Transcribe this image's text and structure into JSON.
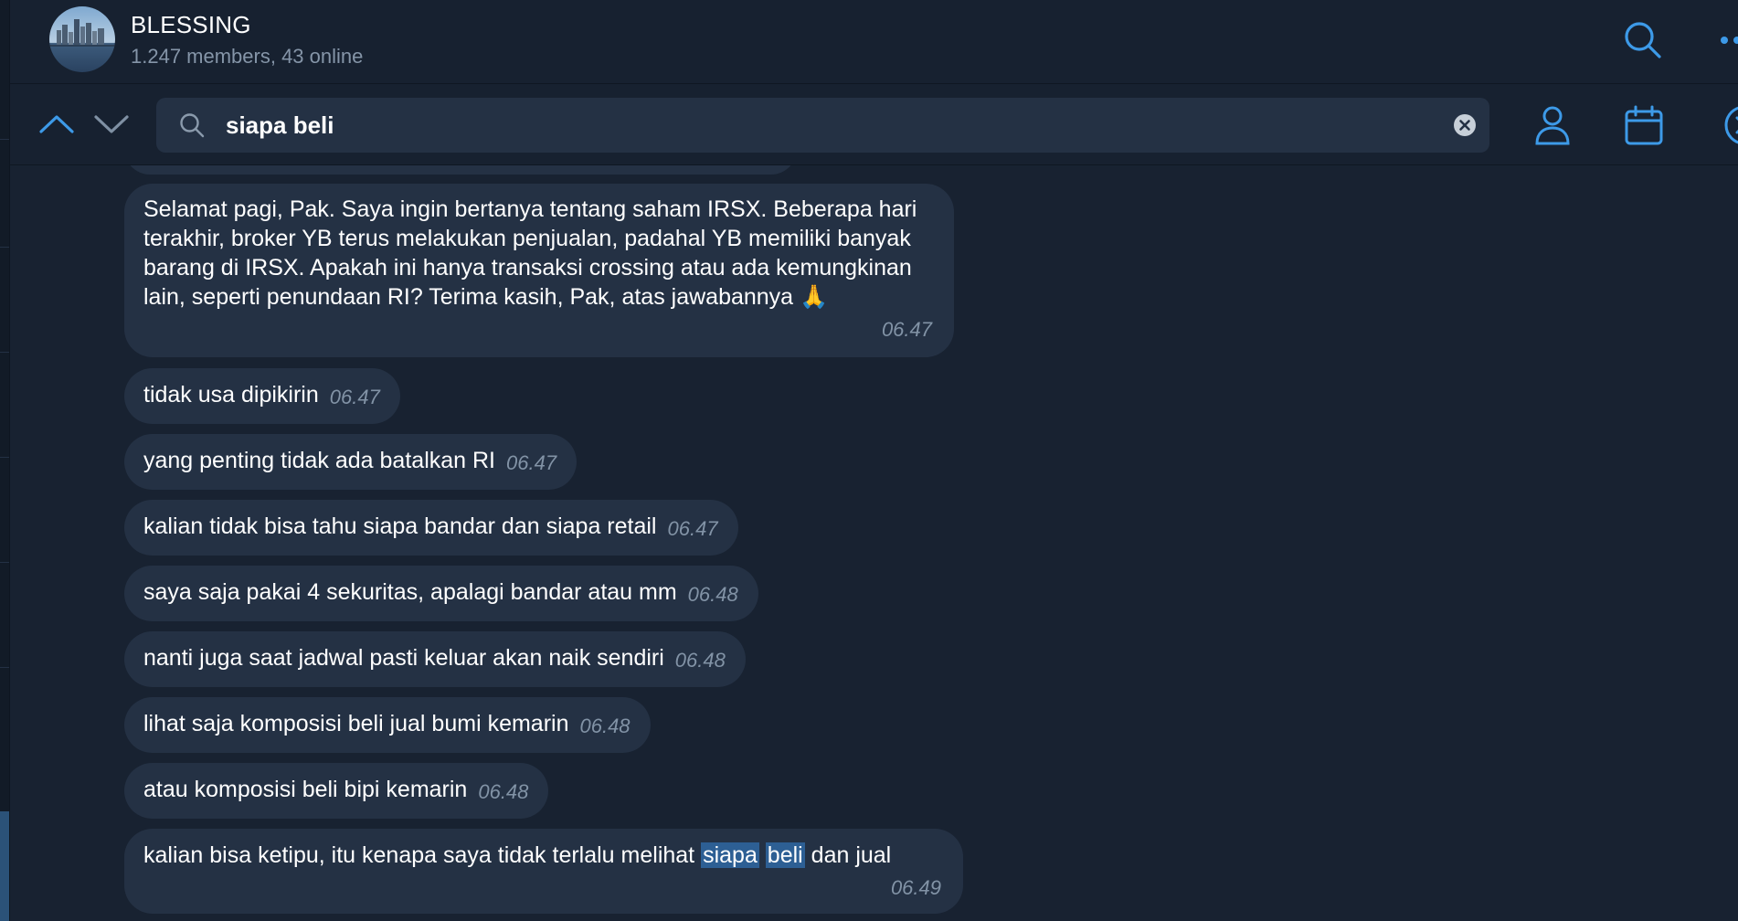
{
  "chat": {
    "title": "BLESSING",
    "subtitle": "1.247 members, 43 online"
  },
  "search": {
    "query": "siapa beli"
  },
  "messages": [
    {
      "text": "Selamat pagi, Pak. Saya ingin bertanya tentang saham IRSX. Beberapa hari terakhir, broker YB terus melakukan penjualan, padahal YB memiliki banyak barang di IRSX. Apakah ini hanya transaksi crossing atau ada kemungkinan lain, seperti penundaan RI? Terima kasih, Pak, atas jawabannya 🙏",
      "time": "06.47"
    },
    {
      "text": "tidak usa dipikirin",
      "time": "06.47"
    },
    {
      "text": "yang penting tidak ada batalkan RI",
      "time": "06.47"
    },
    {
      "text": "kalian tidak bisa tahu siapa bandar dan siapa retail",
      "time": "06.47"
    },
    {
      "text": "saya saja pakai 4 sekuritas, apalagi bandar atau mm",
      "time": "06.48"
    },
    {
      "text": "nanti juga saat jadwal pasti keluar akan naik sendiri",
      "time": "06.48"
    },
    {
      "text": "lihat saja komposisi beli jual bumi kemarin",
      "time": "06.48"
    },
    {
      "text": "atau komposisi beli bipi kemarin",
      "time": "06.48"
    },
    {
      "text_before": "kalian bisa ketipu, itu kenapa saya tidak terlalu melihat ",
      "highlight_1": "siapa",
      "highlight_2": "beli",
      "text_after": " dan jual",
      "time": "06.49"
    }
  ],
  "colors": {
    "background": "#182231",
    "bubble": "#243144",
    "accent": "#3d9ae8",
    "highlight": "#2d5f94",
    "muted_text": "#8595a8"
  },
  "icons": {
    "header": [
      "group-avatar",
      "search-icon",
      "more-icon"
    ],
    "searchbar": [
      "chevron-up-icon",
      "chevron-down-icon",
      "search-icon",
      "clear-icon",
      "user-icon",
      "calendar-icon",
      "close-icon"
    ]
  }
}
